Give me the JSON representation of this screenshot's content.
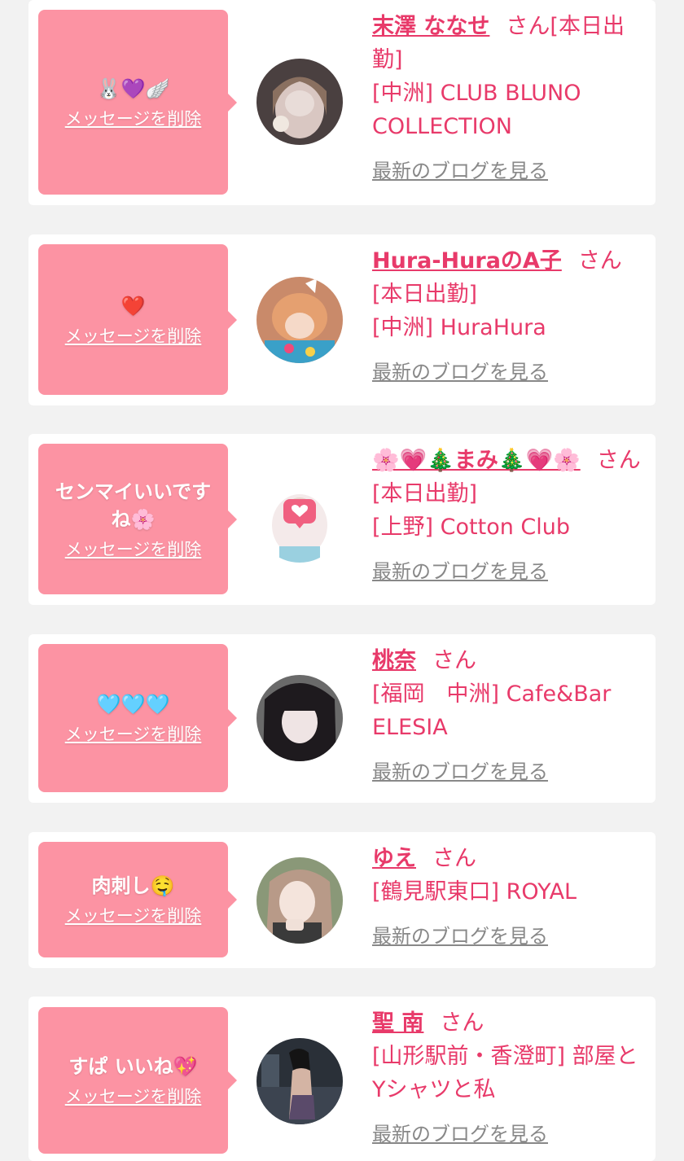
{
  "delete_label": "メッセージを削除",
  "blog_label": "最新のブログを見る",
  "san_label": "さん",
  "colors": {
    "background": "#f2f2f2",
    "card": "#ffffff",
    "bubble": "#fc93a3",
    "accent": "#e83a6a",
    "link_gray": "#888888"
  },
  "entries": [
    {
      "message": "🐰💜🪽",
      "name": "末澤 ななせ",
      "status": "[本日出勤]",
      "shop": "[中洲] CLUB BLUNO COLLECTION"
    },
    {
      "message": "❤️",
      "name": "Hura-HuraのA子",
      "status": "[本日出勤]",
      "shop": "[中洲] HuraHura"
    },
    {
      "message": "センマイいいですね🌸",
      "name": "🌸💗🎄まみ🎄💗🌸",
      "status": "[本日出勤]",
      "shop": "[上野] Cotton Club"
    },
    {
      "message": "🩵🩵🩵",
      "name": "桃奈",
      "status": "",
      "shop": "[福岡　中洲] Cafe&Bar ELESIA"
    },
    {
      "message": "肉刺し🤤",
      "name": "ゆえ",
      "status": "",
      "shop": "[鶴見駅東口] ROYAL"
    },
    {
      "message": "すぱ いいね💖",
      "name": "聖 南",
      "status": "",
      "shop": "[山形駅前・香澄町] 部屋とYシャツと私"
    }
  ]
}
